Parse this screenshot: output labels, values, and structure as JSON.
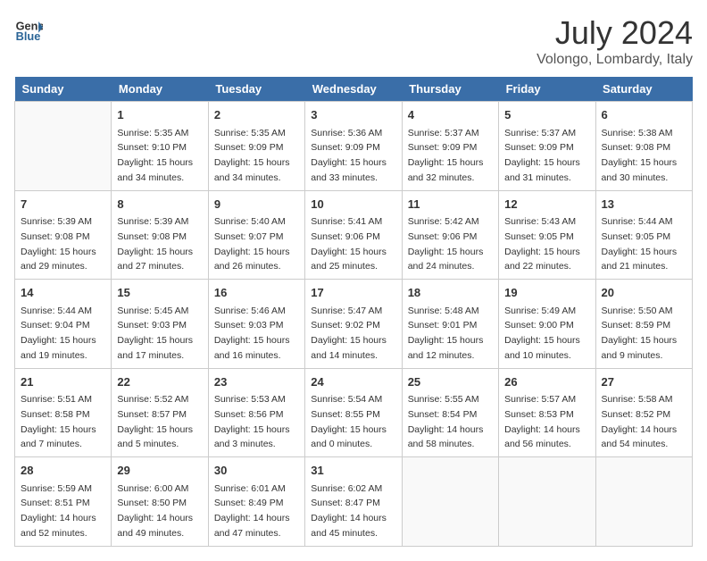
{
  "header": {
    "logo_general": "General",
    "logo_blue": "Blue",
    "title": "July 2024",
    "subtitle": "Volongo, Lombardy, Italy"
  },
  "weekdays": [
    "Sunday",
    "Monday",
    "Tuesday",
    "Wednesday",
    "Thursday",
    "Friday",
    "Saturday"
  ],
  "weeks": [
    [
      {
        "day": "",
        "sunrise": "",
        "sunset": "",
        "daylight": ""
      },
      {
        "day": "1",
        "sunrise": "Sunrise: 5:35 AM",
        "sunset": "Sunset: 9:10 PM",
        "daylight": "Daylight: 15 hours and 34 minutes."
      },
      {
        "day": "2",
        "sunrise": "Sunrise: 5:35 AM",
        "sunset": "Sunset: 9:09 PM",
        "daylight": "Daylight: 15 hours and 34 minutes."
      },
      {
        "day": "3",
        "sunrise": "Sunrise: 5:36 AM",
        "sunset": "Sunset: 9:09 PM",
        "daylight": "Daylight: 15 hours and 33 minutes."
      },
      {
        "day": "4",
        "sunrise": "Sunrise: 5:37 AM",
        "sunset": "Sunset: 9:09 PM",
        "daylight": "Daylight: 15 hours and 32 minutes."
      },
      {
        "day": "5",
        "sunrise": "Sunrise: 5:37 AM",
        "sunset": "Sunset: 9:09 PM",
        "daylight": "Daylight: 15 hours and 31 minutes."
      },
      {
        "day": "6",
        "sunrise": "Sunrise: 5:38 AM",
        "sunset": "Sunset: 9:08 PM",
        "daylight": "Daylight: 15 hours and 30 minutes."
      }
    ],
    [
      {
        "day": "7",
        "sunrise": "Sunrise: 5:39 AM",
        "sunset": "Sunset: 9:08 PM",
        "daylight": "Daylight: 15 hours and 29 minutes."
      },
      {
        "day": "8",
        "sunrise": "Sunrise: 5:39 AM",
        "sunset": "Sunset: 9:08 PM",
        "daylight": "Daylight: 15 hours and 27 minutes."
      },
      {
        "day": "9",
        "sunrise": "Sunrise: 5:40 AM",
        "sunset": "Sunset: 9:07 PM",
        "daylight": "Daylight: 15 hours and 26 minutes."
      },
      {
        "day": "10",
        "sunrise": "Sunrise: 5:41 AM",
        "sunset": "Sunset: 9:06 PM",
        "daylight": "Daylight: 15 hours and 25 minutes."
      },
      {
        "day": "11",
        "sunrise": "Sunrise: 5:42 AM",
        "sunset": "Sunset: 9:06 PM",
        "daylight": "Daylight: 15 hours and 24 minutes."
      },
      {
        "day": "12",
        "sunrise": "Sunrise: 5:43 AM",
        "sunset": "Sunset: 9:05 PM",
        "daylight": "Daylight: 15 hours and 22 minutes."
      },
      {
        "day": "13",
        "sunrise": "Sunrise: 5:44 AM",
        "sunset": "Sunset: 9:05 PM",
        "daylight": "Daylight: 15 hours and 21 minutes."
      }
    ],
    [
      {
        "day": "14",
        "sunrise": "Sunrise: 5:44 AM",
        "sunset": "Sunset: 9:04 PM",
        "daylight": "Daylight: 15 hours and 19 minutes."
      },
      {
        "day": "15",
        "sunrise": "Sunrise: 5:45 AM",
        "sunset": "Sunset: 9:03 PM",
        "daylight": "Daylight: 15 hours and 17 minutes."
      },
      {
        "day": "16",
        "sunrise": "Sunrise: 5:46 AM",
        "sunset": "Sunset: 9:03 PM",
        "daylight": "Daylight: 15 hours and 16 minutes."
      },
      {
        "day": "17",
        "sunrise": "Sunrise: 5:47 AM",
        "sunset": "Sunset: 9:02 PM",
        "daylight": "Daylight: 15 hours and 14 minutes."
      },
      {
        "day": "18",
        "sunrise": "Sunrise: 5:48 AM",
        "sunset": "Sunset: 9:01 PM",
        "daylight": "Daylight: 15 hours and 12 minutes."
      },
      {
        "day": "19",
        "sunrise": "Sunrise: 5:49 AM",
        "sunset": "Sunset: 9:00 PM",
        "daylight": "Daylight: 15 hours and 10 minutes."
      },
      {
        "day": "20",
        "sunrise": "Sunrise: 5:50 AM",
        "sunset": "Sunset: 8:59 PM",
        "daylight": "Daylight: 15 hours and 9 minutes."
      }
    ],
    [
      {
        "day": "21",
        "sunrise": "Sunrise: 5:51 AM",
        "sunset": "Sunset: 8:58 PM",
        "daylight": "Daylight: 15 hours and 7 minutes."
      },
      {
        "day": "22",
        "sunrise": "Sunrise: 5:52 AM",
        "sunset": "Sunset: 8:57 PM",
        "daylight": "Daylight: 15 hours and 5 minutes."
      },
      {
        "day": "23",
        "sunrise": "Sunrise: 5:53 AM",
        "sunset": "Sunset: 8:56 PM",
        "daylight": "Daylight: 15 hours and 3 minutes."
      },
      {
        "day": "24",
        "sunrise": "Sunrise: 5:54 AM",
        "sunset": "Sunset: 8:55 PM",
        "daylight": "Daylight: 15 hours and 0 minutes."
      },
      {
        "day": "25",
        "sunrise": "Sunrise: 5:55 AM",
        "sunset": "Sunset: 8:54 PM",
        "daylight": "Daylight: 14 hours and 58 minutes."
      },
      {
        "day": "26",
        "sunrise": "Sunrise: 5:57 AM",
        "sunset": "Sunset: 8:53 PM",
        "daylight": "Daylight: 14 hours and 56 minutes."
      },
      {
        "day": "27",
        "sunrise": "Sunrise: 5:58 AM",
        "sunset": "Sunset: 8:52 PM",
        "daylight": "Daylight: 14 hours and 54 minutes."
      }
    ],
    [
      {
        "day": "28",
        "sunrise": "Sunrise: 5:59 AM",
        "sunset": "Sunset: 8:51 PM",
        "daylight": "Daylight: 14 hours and 52 minutes."
      },
      {
        "day": "29",
        "sunrise": "Sunrise: 6:00 AM",
        "sunset": "Sunset: 8:50 PM",
        "daylight": "Daylight: 14 hours and 49 minutes."
      },
      {
        "day": "30",
        "sunrise": "Sunrise: 6:01 AM",
        "sunset": "Sunset: 8:49 PM",
        "daylight": "Daylight: 14 hours and 47 minutes."
      },
      {
        "day": "31",
        "sunrise": "Sunrise: 6:02 AM",
        "sunset": "Sunset: 8:47 PM",
        "daylight": "Daylight: 14 hours and 45 minutes."
      },
      {
        "day": "",
        "sunrise": "",
        "sunset": "",
        "daylight": ""
      },
      {
        "day": "",
        "sunrise": "",
        "sunset": "",
        "daylight": ""
      },
      {
        "day": "",
        "sunrise": "",
        "sunset": "",
        "daylight": ""
      }
    ]
  ]
}
